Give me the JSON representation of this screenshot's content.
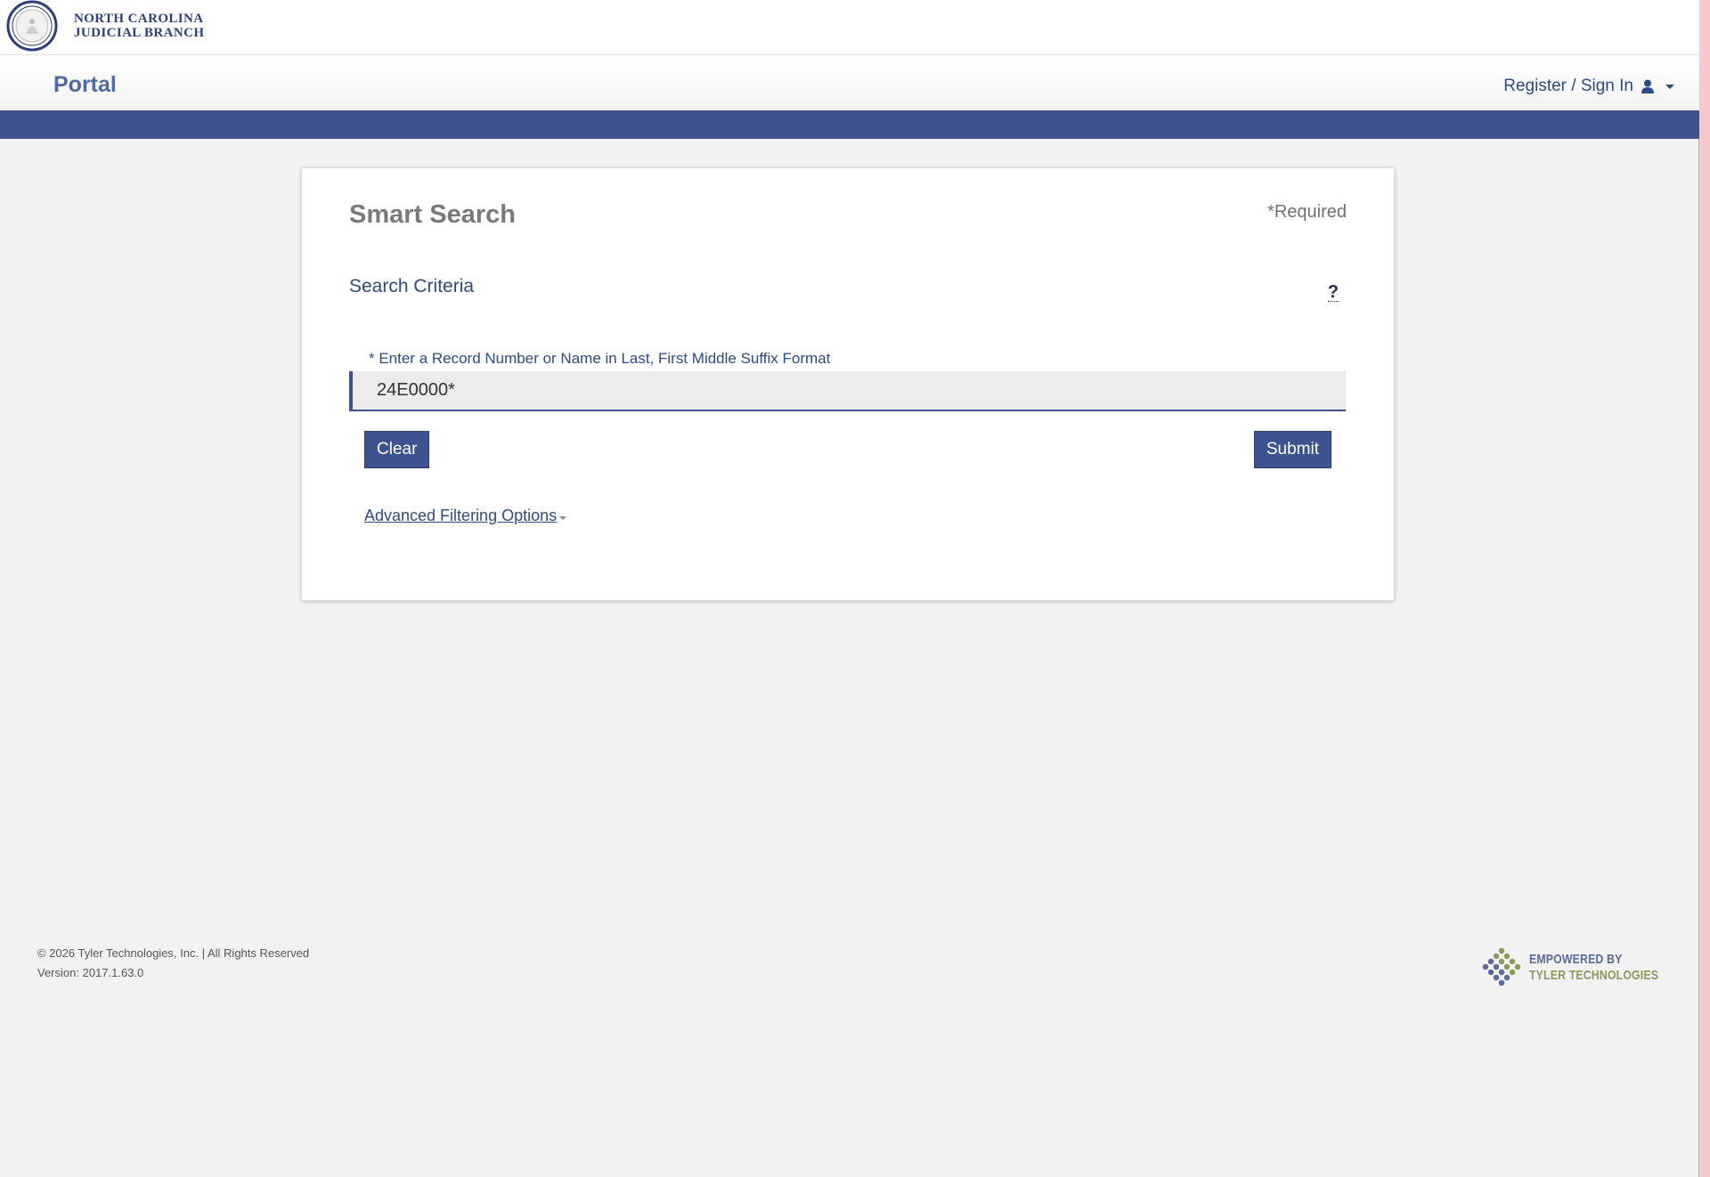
{
  "brand": {
    "line1": "NORTH CAROLINA",
    "line2": "JUDICIAL BRANCH"
  },
  "nav": {
    "portal": "Portal",
    "signin": "Register / Sign In"
  },
  "search": {
    "title": "Smart Search",
    "required": "*Required",
    "criteria": "Search Criteria",
    "help": "?",
    "field_label": "* Enter a Record Number or Name in Last, First Middle Suffix Format",
    "value": "24E0000*",
    "clear_label": "Clear",
    "submit_label": "Submit",
    "advanced_label": "Advanced Filtering Options"
  },
  "footer": {
    "copyright": "© 2026 Tyler Technologies, Inc. | All Rights Reserved",
    "version": "Version: 2017.1.63.0",
    "tyler_line1": "EMPOWERED BY",
    "tyler_line2": "TYLER TECHNOLOGIES"
  },
  "colors": {
    "accent": "#3d528f",
    "link": "#2d4a82",
    "background": "#f2f2f2"
  }
}
